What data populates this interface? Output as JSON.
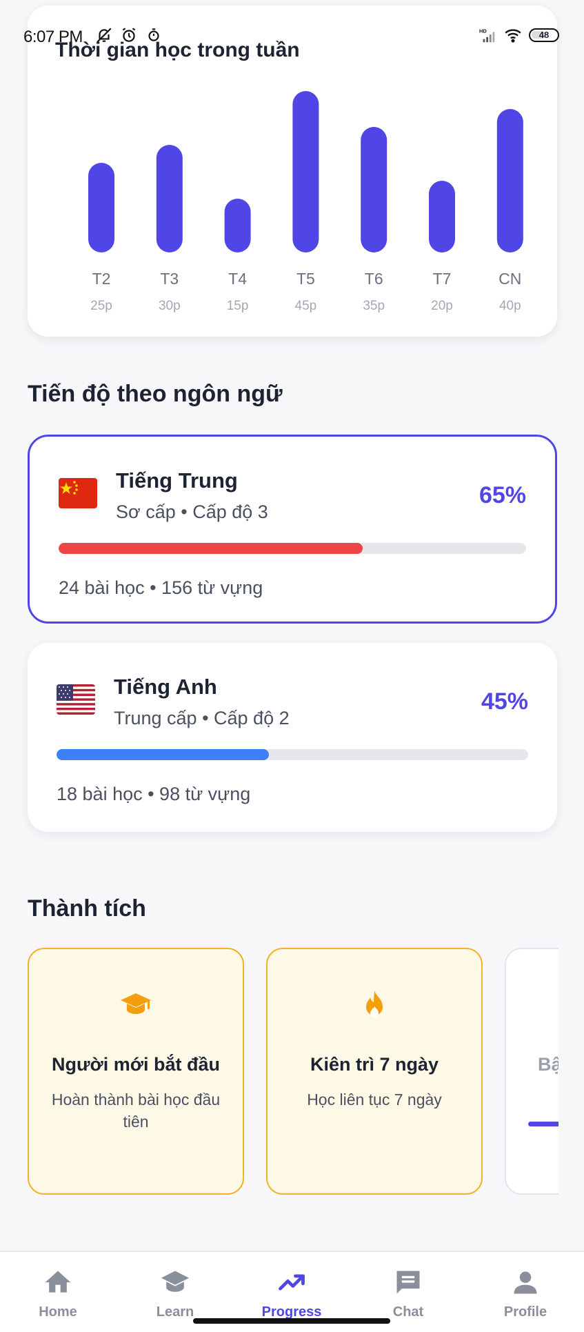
{
  "status_bar": {
    "time": "6:07 PM",
    "battery": "48",
    "icons": [
      "mute-bell-icon",
      "alarm-icon",
      "timer-icon",
      "hd-signal-icon",
      "wifi-icon",
      "battery-icon"
    ]
  },
  "weekly_chart": {
    "title": "Thời gian học trong tuần",
    "bar_color": "#4f46e5"
  },
  "chart_data": {
    "type": "bar",
    "title": "Thời gian học trong tuần",
    "categories": [
      "T2",
      "T3",
      "T4",
      "T5",
      "T6",
      "T7",
      "CN"
    ],
    "values": [
      25,
      30,
      15,
      45,
      35,
      20,
      40
    ],
    "value_labels": [
      "25p",
      "30p",
      "15p",
      "45p",
      "35p",
      "20p",
      "40p"
    ],
    "ylim": [
      0,
      45
    ],
    "grid": false,
    "legend": "none"
  },
  "language_section": {
    "title": "Tiến độ theo ngôn ngữ",
    "languages": [
      {
        "name": "Tiếng Trung",
        "level": "Sơ cấp • Cấp độ 3",
        "percent_label": "65%",
        "progress": 0.65,
        "stats": "24 bài học • 156 từ vựng",
        "bar_color": "#ef4444",
        "flag_icon": "china-flag-icon",
        "selected": true
      },
      {
        "name": "Tiếng Anh",
        "level": "Trung cấp • Cấp độ 2",
        "percent_label": "45%",
        "progress": 0.45,
        "stats": "18 bài học • 98 từ vựng",
        "bar_color": "#3b82f6",
        "flag_icon": "usa-flag-icon",
        "selected": false
      }
    ]
  },
  "achievements_section": {
    "title": "Thành tích",
    "items": [
      {
        "title": "Người mới bắt đầu",
        "description": "Hoàn thành bài học đầu tiên",
        "icon": "graduation-cap-icon"
      },
      {
        "title": "Kiên trì 7 ngày",
        "description": "Học liên tục 7 ngày",
        "icon": "flame-icon"
      },
      {
        "title": "Bậ",
        "icon": ""
      }
    ],
    "accent_color": "#f0b429"
  },
  "bottom_nav": {
    "items": [
      {
        "label": "Home",
        "icon": "home-icon"
      },
      {
        "label": "Learn",
        "icon": "graduation-cap-icon"
      },
      {
        "label": "Progress",
        "icon": "trend-up-icon"
      },
      {
        "label": "Chat",
        "icon": "chat-icon"
      },
      {
        "label": "Profile",
        "icon": "person-icon"
      }
    ],
    "active_index": 2,
    "active_color": "#4f46e5"
  }
}
